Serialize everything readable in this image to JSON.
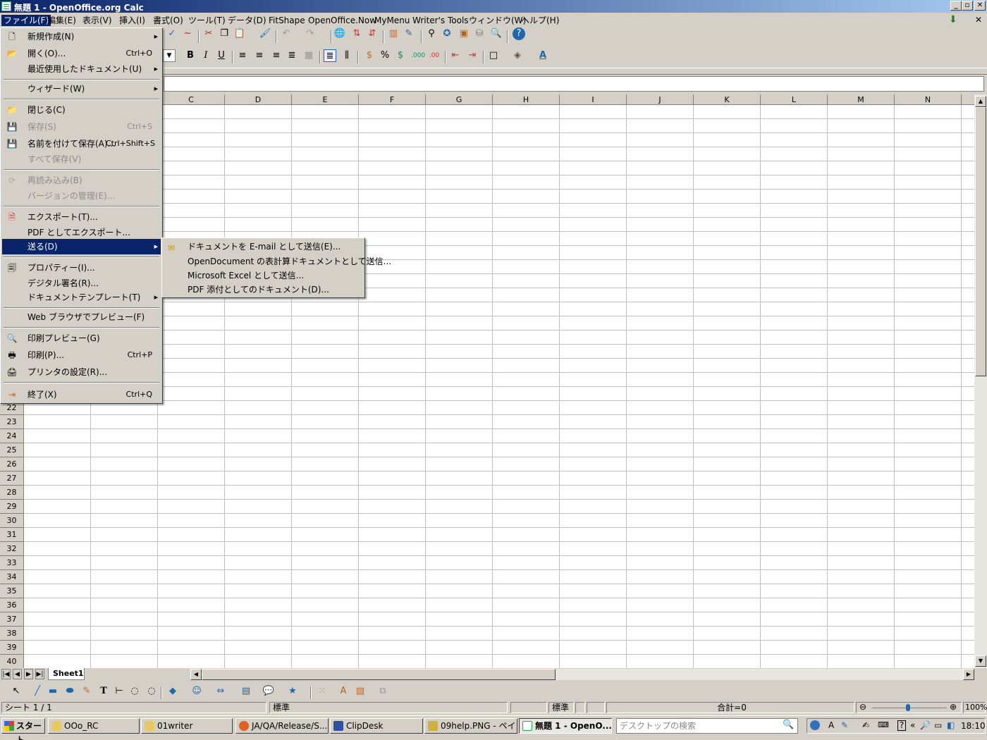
{
  "window": {
    "title": "無題 1 - OpenOffice.org Calc",
    "buttons": [
      "_",
      "▫",
      "✕"
    ]
  },
  "menubar": {
    "items": [
      "ファイル(F)",
      "編集(E)",
      "表示(V)",
      "挿入(I)",
      "書式(O)",
      "ツール(T)",
      "データ(D)",
      "FitShape",
      "OpenOffice.Now",
      "MyMenu",
      "Writer's Tools",
      "ウィンドウ(W)",
      "ヘルプ(H)"
    ]
  },
  "file_menu": {
    "items": [
      {
        "label": "新規作成(N)",
        "accel": "",
        "submenu": true
      },
      {
        "label": "開く(O)...",
        "accel": "Ctrl+O"
      },
      {
        "label": "最近使用したドキュメント(U)",
        "accel": "",
        "submenu": true
      },
      {
        "label": "ウィザード(W)",
        "accel": "",
        "submenu": true
      },
      {
        "label": "閉じる(C)",
        "accel": ""
      },
      {
        "label": "保存(S)",
        "accel": "Ctrl+S"
      },
      {
        "label": "名前を付けて保存(A)...",
        "accel": "Ctrl+Shift+S"
      },
      {
        "label": "すべて保存(V)",
        "accel": ""
      },
      {
        "label": "再読み込み(B)",
        "accel": ""
      },
      {
        "label": "バージョンの管理(E)...",
        "accel": ""
      },
      {
        "label": "エクスポート(T)...",
        "accel": ""
      },
      {
        "label": "PDF としてエクスポート...",
        "accel": ""
      },
      {
        "label": "送る(D)",
        "accel": "",
        "submenu": true
      },
      {
        "label": "プロパティー(I)...",
        "accel": ""
      },
      {
        "label": "デジタル署名(R)...",
        "accel": ""
      },
      {
        "label": "ドキュメントテンプレート(T)",
        "accel": "",
        "submenu": true
      },
      {
        "label": "Web ブラウザでプレビュー(F)",
        "accel": ""
      },
      {
        "label": "印刷プレビュー(G)",
        "accel": ""
      },
      {
        "label": "印刷(P)...",
        "accel": "Ctrl+P"
      },
      {
        "label": "プリンタの設定(R)...",
        "accel": ""
      },
      {
        "label": "終了(X)",
        "accel": "Ctrl+Q"
      }
    ]
  },
  "send_submenu": {
    "items": [
      "ドキュメントを E-mail として送信(E)...",
      "OpenDocument の表計算ドキュメントとして送信...",
      "Microsoft Excel として送信...",
      "PDF 添付としてのドキュメント(D)..."
    ]
  },
  "grid": {
    "columns": [
      "C",
      "D",
      "E",
      "F",
      "G",
      "H",
      "I",
      "J",
      "K",
      "L",
      "M",
      "N"
    ],
    "rows": [
      "22",
      "23",
      "24",
      "25",
      "26",
      "27",
      "28",
      "29",
      "30",
      "31",
      "32",
      "33",
      "34",
      "35",
      "36",
      "37",
      "38",
      "39",
      "40"
    ]
  },
  "sheet_tab": "Sheet1",
  "statusbar": {
    "sheet": "シート 1 / 1",
    "style": "標準",
    "mode": "標準",
    "sum": "合計=0",
    "zoom": "100%"
  },
  "taskbar": {
    "start": "スタート",
    "tasks": [
      "OOo_RC",
      "01writer",
      "JA/QA/Release/S...",
      "ClipDesk",
      "09help.PNG - ペイ...",
      "無題 1 - OpenO..."
    ],
    "search_placeholder": "デスクトップの検索",
    "clock": "18:10"
  },
  "colors": {
    "titlebar_start": "#0a246a",
    "titlebar_end": "#a6caf0",
    "menu_highlight": "#0a246a",
    "chrome": "#d4d0c8"
  }
}
